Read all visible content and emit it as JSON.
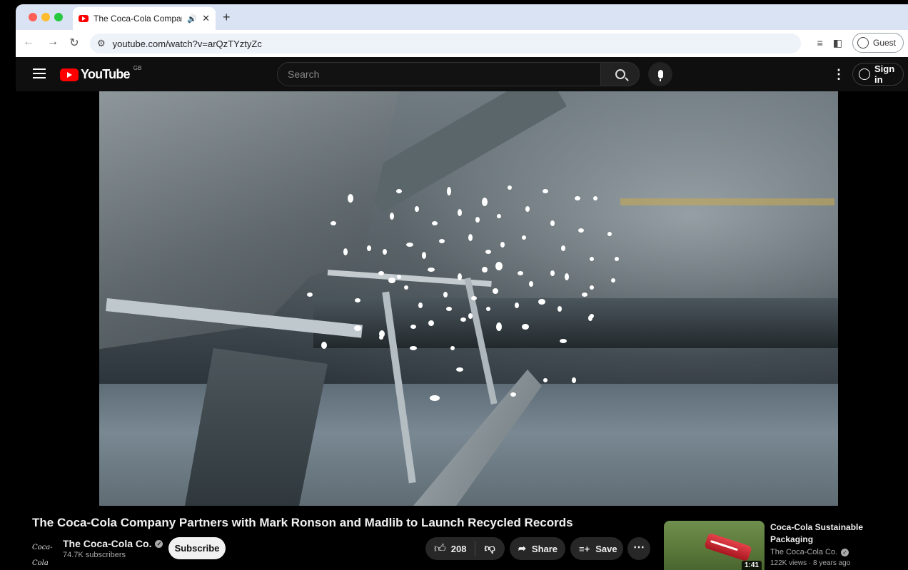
{
  "browser": {
    "tab_title": "The Coca-Cola Company",
    "tab_sound_icon": "speaker-icon",
    "url": "youtube.com/watch?v=arQzTYztyZc",
    "profile_label": "Guest"
  },
  "masthead": {
    "logo_text": "YouTube",
    "region": "GB",
    "search_placeholder": "Search",
    "sign_in_label": "Sign in"
  },
  "video": {
    "title": "The Coca-Cola Company Partners with Mark Ronson and Madlib to Launch Recycled Records",
    "channel_name": "The Coca-Cola Co.",
    "subscribers": "74.7K subscribers",
    "subscribe_label": "Subscribe",
    "like_count": "208",
    "share_label": "Share",
    "save_label": "Save"
  },
  "recommendation": {
    "title": "Coca-Cola Sustainable Packaging",
    "channel": "The Coca-Cola Co.",
    "meta": "122K views · 8 years ago",
    "duration": "1:41"
  },
  "colors": {
    "yt_red": "#ff0000",
    "masthead_bg": "#0f0f0f",
    "pill_bg": "#272727",
    "browser_frame": "#d9e3f3"
  }
}
